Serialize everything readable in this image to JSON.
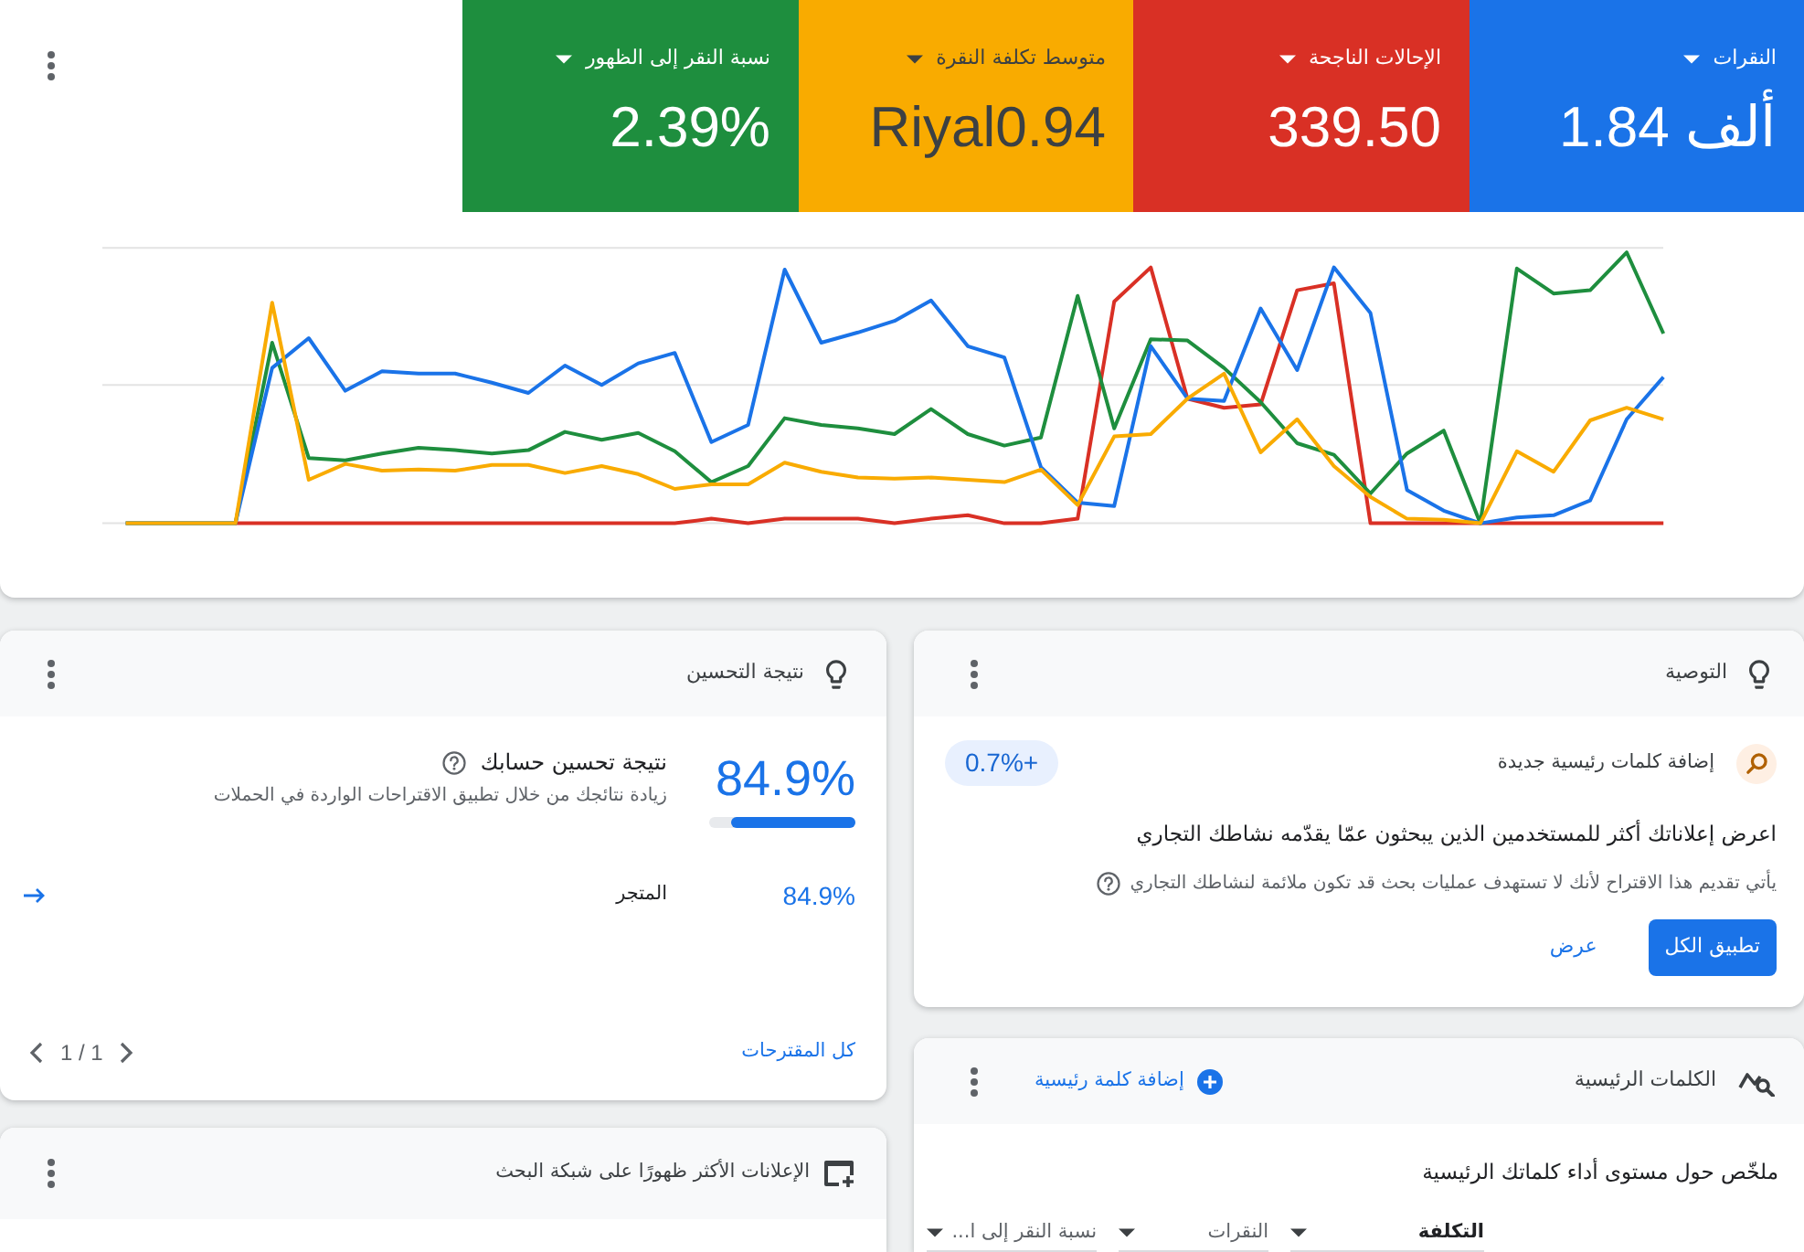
{
  "metrics": [
    {
      "label": "النقرات",
      "value": "1.84 ألف",
      "color": "#1a73e8"
    },
    {
      "label": "الإحالات الناجحة",
      "value": "339.50",
      "color": "#d93025"
    },
    {
      "label": "متوسط تكلفة النقرة",
      "value": "Riyal0.94",
      "color": "#f9ab00"
    },
    {
      "label": "نسبة النقر إلى الظهور",
      "value": "2.39%",
      "color": "#1e8e3e"
    }
  ],
  "recommendation": {
    "title": "التوصية",
    "type": "إضافة كلمات رئيسية جديدة",
    "uplift": "+0.7%",
    "headline": "اعرض إعلاناتك أكثر للمستخدمين الذين يبحثون عمّا يقدّمه نشاطك التجاري",
    "reason": "يأتي تقديم هذا الاقتراح لأنك لا تستهدف عمليات بحث قد تكون ملائمة لنشاطك التجاري",
    "buttons": [
      {
        "label": "تطبيق الكل",
        "kind": "primary"
      },
      {
        "label": "عرض",
        "kind": "text"
      }
    ]
  },
  "optimization_score": {
    "title": "نتيجة التحسين",
    "score": "84.9%",
    "level": 0.849,
    "heading": "نتيجة تحسين حسابك",
    "description": "زيادة نتائجك من خلال تطبيق الاقتراحات الواردة في الحملات",
    "rows": [
      {
        "score": "84.9%",
        "name": "المتجر"
      }
    ],
    "link": "كل المقترحات",
    "pagination": "1 / 1"
  },
  "keywords": {
    "title": "الكلمات الرئيسية",
    "add_label": "إضافة كلمة رئيسية",
    "summary": "ملخّص حول مستوى أداء كلماتك الرئيسية",
    "columns": [
      {
        "label": "التكلفة",
        "sorted": true
      },
      {
        "label": "النقرات",
        "sorted": false
      },
      {
        "label": "نسبة النقر إلى ا...",
        "sorted": false
      }
    ]
  },
  "top_ads": {
    "title": "الإعلانات الأكثر ظهورًا على شبكة البحث"
  }
}
